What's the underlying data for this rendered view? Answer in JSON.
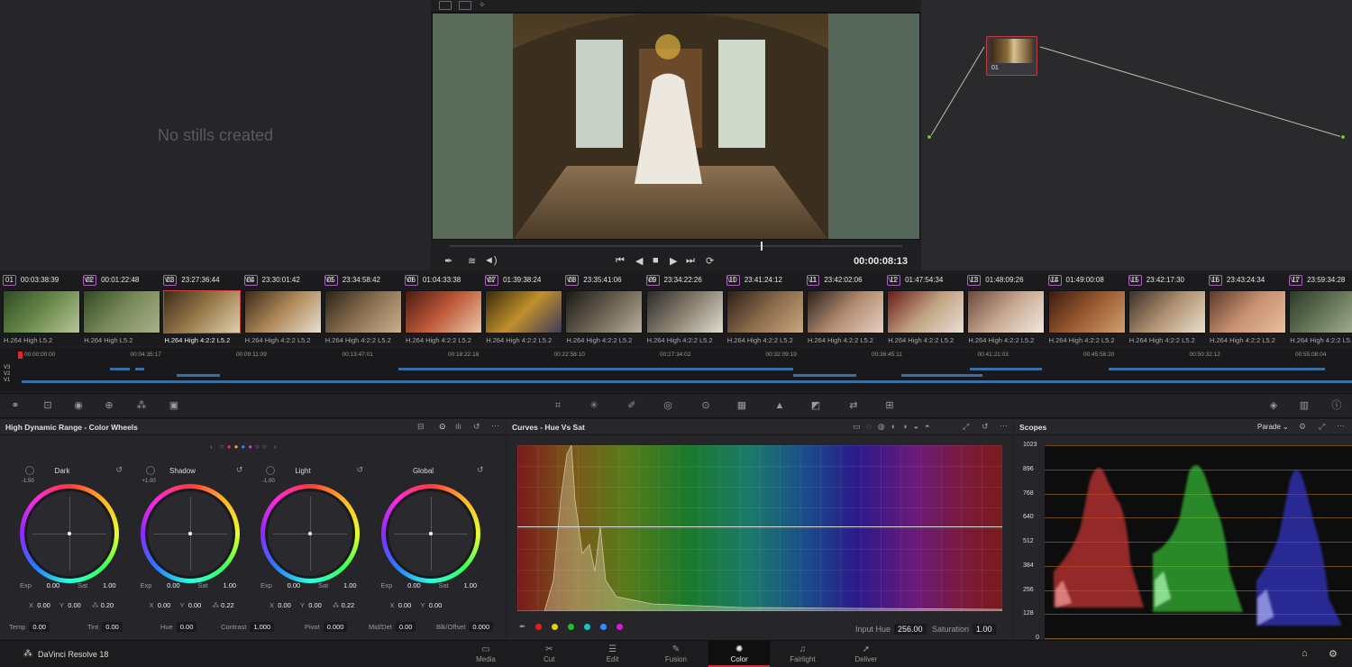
{
  "app": {
    "name": "DaVinci Resolve 18"
  },
  "gallery": {
    "empty_message": "No stills created"
  },
  "viewer": {
    "timecode": "00:00:08:13"
  },
  "node_graph": {
    "node_label": "01"
  },
  "clips": [
    {
      "num": "01",
      "tc": "00:03:38:39",
      "track": "V1",
      "codec": "H.264 High L5.2",
      "colors": [
        "#2e4a26",
        "#6a8a4a",
        "#b8c49a"
      ]
    },
    {
      "num": "02",
      "tc": "00:01:22:48",
      "track": "V1",
      "codec": "H.264 High L5.2",
      "colors": [
        "#2e4a22",
        "#7a8a5a",
        "#a8b08a"
      ]
    },
    {
      "num": "03",
      "tc": "23:27:36:44",
      "track": "V1",
      "codec": "H.264 High 4:2:2 L5.2",
      "colors": [
        "#3a2c1a",
        "#9a7a4a",
        "#e0d0b0"
      ]
    },
    {
      "num": "04",
      "tc": "23:30:01:42",
      "track": "V1",
      "codec": "H.264 High 4:2:2 L5.2",
      "colors": [
        "#3a2a18",
        "#b08a5a",
        "#e8e0d0"
      ]
    },
    {
      "num": "05",
      "tc": "23:34:58:42",
      "track": "V1",
      "codec": "H.264 High 4:2:2 L5.2",
      "colors": [
        "#2a2218",
        "#8a7050",
        "#c8b090"
      ]
    },
    {
      "num": "06",
      "tc": "01:04:33:38",
      "track": "V1",
      "codec": "H.264 High 4:2:2 L5.2",
      "colors": [
        "#4a1a10",
        "#c05a3a",
        "#e8c8a8"
      ]
    },
    {
      "num": "07",
      "tc": "01:39:38:24",
      "track": "V1",
      "codec": "H.264 High 4:2:2 L5.2",
      "colors": [
        "#3a2a10",
        "#c0902a",
        "#403a5a"
      ]
    },
    {
      "num": "08",
      "tc": "23:35:41:06",
      "track": "V1",
      "codec": "H.264 High 4:2:2 L5.2",
      "colors": [
        "#1a1a18",
        "#6a6050",
        "#b8b0a0"
      ]
    },
    {
      "num": "09",
      "tc": "23:34:22:26",
      "track": "V1",
      "codec": "H.264 High 4:2:2 L5.2",
      "colors": [
        "#2a2a2a",
        "#8a8070",
        "#e0dcd0"
      ]
    },
    {
      "num": "10",
      "tc": "23:41:24:12",
      "track": "V1",
      "codec": "H.264 High 4:2:2 L5.2",
      "colors": [
        "#2a2018",
        "#8a6a4a",
        "#c8a880"
      ]
    },
    {
      "num": "11",
      "tc": "23:42:02:06",
      "track": "V1",
      "codec": "H.264 High 4:2:2 L5.2",
      "colors": [
        "#2a2018",
        "#b08a70",
        "#e8d0c0"
      ]
    },
    {
      "num": "12",
      "tc": "01:47:54:34",
      "track": "V1",
      "codec": "H.264 High 4:2:2 L5.2",
      "colors": [
        "#6a1a1a",
        "#c0a080",
        "#e8e0d8"
      ]
    },
    {
      "num": "13",
      "tc": "01:48:09:26",
      "track": "V1",
      "codec": "H.264 High 4:2:2 L5.2",
      "colors": [
        "#6a4a3a",
        "#c8a890",
        "#f0e8e0"
      ]
    },
    {
      "num": "14",
      "tc": "01:49:00:08",
      "track": "V1",
      "codec": "H.264 High 4:2:2 L5.2",
      "colors": [
        "#3a1a10",
        "#9a5a30",
        "#d0a070"
      ]
    },
    {
      "num": "15",
      "tc": "23:42:17:30",
      "track": "V1",
      "codec": "H.264 High 4:2:2 L5.2",
      "colors": [
        "#3a3028",
        "#b09070",
        "#e8e0d0"
      ]
    },
    {
      "num": "16",
      "tc": "23:43:24:34",
      "track": "V1",
      "codec": "H.264 High 4:2:2 L5.2",
      "colors": [
        "#5a3a2a",
        "#c89070",
        "#e8c0a0"
      ]
    },
    {
      "num": "17",
      "tc": "23:59:34:28",
      "track": "V1",
      "codec": "H.264 High 4:2:2 L5.2",
      "colors": [
        "#2a3a2a",
        "#6a7a5a",
        "#b0b8a0"
      ]
    }
  ],
  "timeline": {
    "ruler": [
      "00:00:00:00",
      "00:04:35:17",
      "00:09:11:09",
      "00:13:47:01",
      "00:18:22:18",
      "00:22:58:10",
      "00:27:34:02",
      "00:32:09:19",
      "00:36:45:11",
      "00:41:21:03",
      "00:45:56:20",
      "00:50:32:12",
      "00:55:08:04"
    ],
    "tracks": [
      "V3",
      "V2",
      "V1"
    ]
  },
  "wheels_panel": {
    "title": "High Dynamic Range - Color Wheels",
    "wheels": [
      {
        "name": "Dark",
        "zone": "-1.50",
        "exp": "0.00",
        "sat": "1.00",
        "x": "0.00",
        "y": "0.00",
        "lum": "0.20"
      },
      {
        "name": "Shadow",
        "zone": "+1.00",
        "exp": "0.00",
        "sat": "1.00",
        "x": "0.00",
        "y": "0.00",
        "lum": "0.22"
      },
      {
        "name": "Light",
        "zone": "-1.00",
        "exp": "0.00",
        "sat": "1.00",
        "x": "0.00",
        "y": "0.00",
        "lum": "0.22"
      },
      {
        "name": "Global",
        "zone": "",
        "exp": "0.00",
        "sat": "1.00",
        "x": "0.00",
        "y": "0.00",
        "lum": ""
      }
    ],
    "labels": {
      "exp": "Exp",
      "sat": "Sat",
      "x": "X",
      "y": "Y"
    },
    "bottom": {
      "temp_label": "Temp",
      "temp": "0.00",
      "tint_label": "Tint",
      "tint": "0.00",
      "hue_label": "Hue",
      "hue": "0.00",
      "contrast_label": "Contrast",
      "contrast": "1.000",
      "pivot_label": "Pivot",
      "pivot": "0.000",
      "middet_label": "Mid/Det",
      "middet": "0.00",
      "blkoff_label": "Blk/Offset",
      "blkoff": "0.000"
    }
  },
  "curves_panel": {
    "title": "Curves - Hue Vs Sat",
    "input_hue_label": "Input Hue",
    "input_hue": "256.00",
    "saturation_label": "Saturation",
    "saturation": "1.00",
    "dots": [
      "#e02020",
      "#e0d020",
      "#20c020",
      "#20c0c0",
      "#3a8aff",
      "#d020d0"
    ]
  },
  "scopes_panel": {
    "title": "Scopes",
    "mode": "Parade",
    "y_ticks": [
      "1023",
      "896",
      "768",
      "640",
      "512",
      "384",
      "256",
      "128",
      "0"
    ]
  },
  "pages": [
    {
      "label": "Media",
      "icon": "▭"
    },
    {
      "label": "Cut",
      "icon": "✂"
    },
    {
      "label": "Edit",
      "icon": "☰"
    },
    {
      "label": "Fusion",
      "icon": "✎"
    },
    {
      "label": "Color",
      "icon": "✺"
    },
    {
      "label": "Fairlight",
      "icon": "♫"
    },
    {
      "label": "Deliver",
      "icon": "➚"
    }
  ],
  "active_page": "Color"
}
